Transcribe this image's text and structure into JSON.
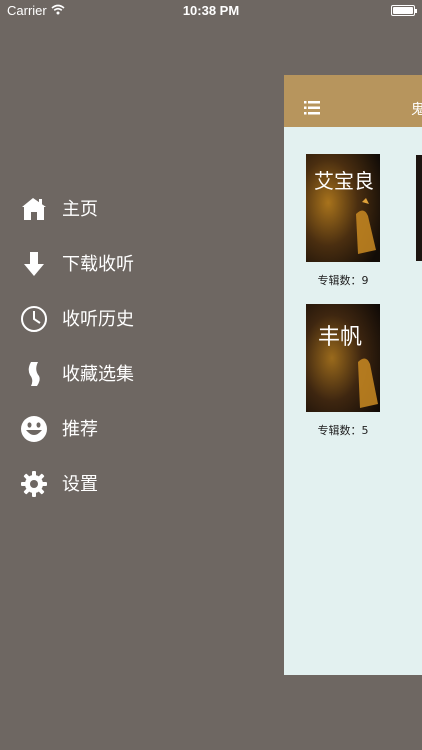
{
  "status_bar": {
    "carrier": "Carrier",
    "time": "10:38 PM"
  },
  "menu": {
    "items": [
      {
        "label": "主页",
        "icon": "home-icon"
      },
      {
        "label": "下载收听",
        "icon": "download-arrow-icon"
      },
      {
        "label": "收听历史",
        "icon": "clock-icon"
      },
      {
        "label": "收藏选集",
        "icon": "ribbon-icon"
      },
      {
        "label": "推荐",
        "icon": "smiley-icon"
      },
      {
        "label": "设置",
        "icon": "gear-icon"
      }
    ]
  },
  "content": {
    "title": "鬼",
    "books": [
      {
        "cover_text": "艾宝良",
        "caption": "专辑数：9"
      },
      {
        "cover_text": "丰帆",
        "caption": "专辑数：5"
      }
    ]
  },
  "colors": {
    "background": "#6e6762",
    "navbar": "#b7955d",
    "panel": "#e3f1f0"
  }
}
